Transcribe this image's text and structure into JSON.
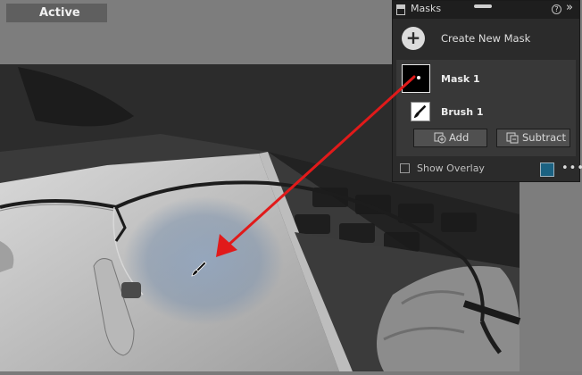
{
  "viewer": {
    "status_label": "Active"
  },
  "masks_panel": {
    "title": "Masks",
    "help_label": "?",
    "collapse_label": "»",
    "create_label": "Create New Mask",
    "mask_name": "Mask 1",
    "brush_name": "Brush 1",
    "add_label": "Add",
    "subtract_label": "Subtract",
    "show_overlay_label": "Show Overlay",
    "overlay_checked": false,
    "overlay_color": "#1b6282",
    "more_label": "•••"
  },
  "colors": {
    "arrow": "#e11a1a",
    "panel_bg": "#2b2b2b",
    "mask_group_bg": "#383838"
  },
  "icons": {
    "brush": "brush-icon",
    "cursor": "brush-cursor-icon",
    "add": "add-mask-icon",
    "subtract": "subtract-mask-icon"
  }
}
